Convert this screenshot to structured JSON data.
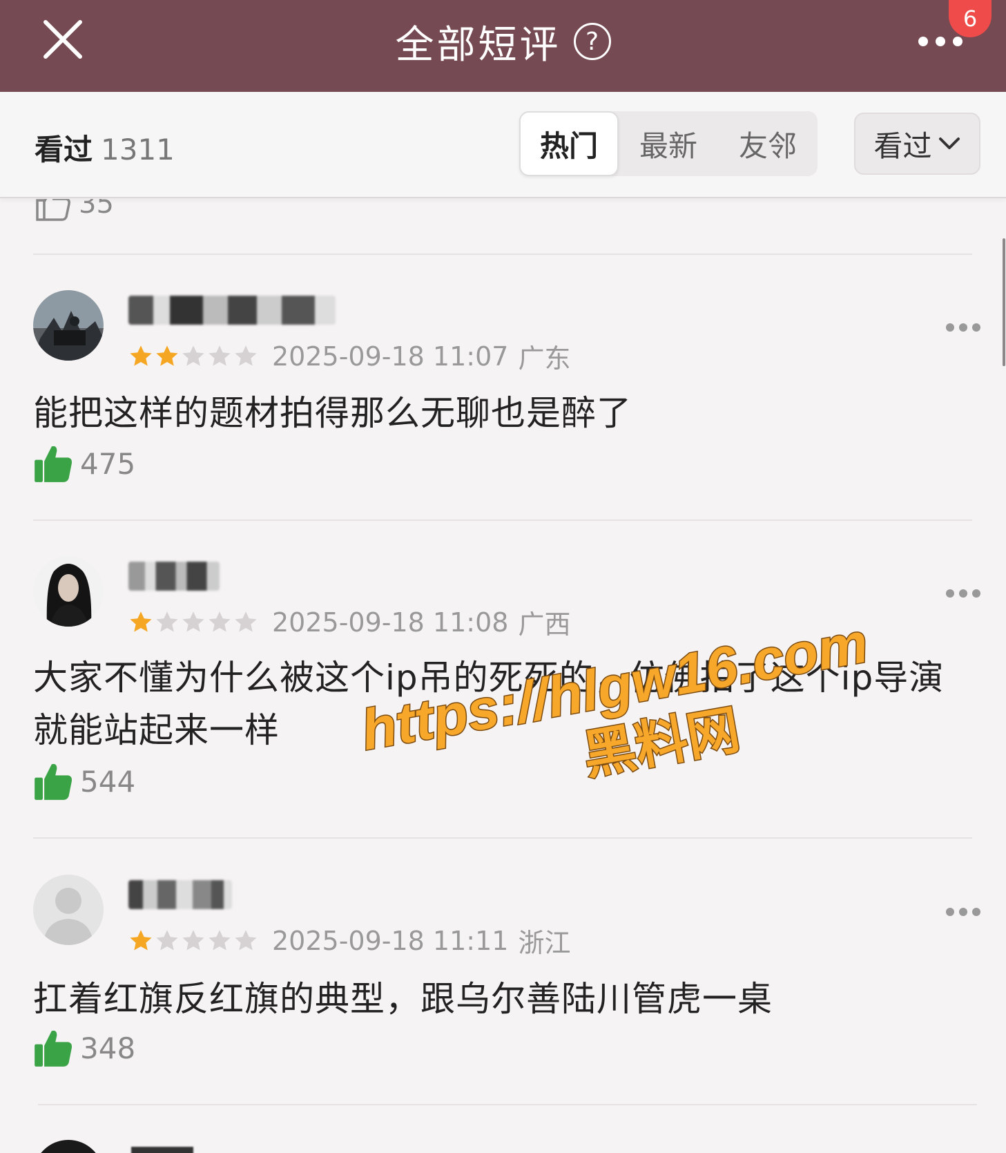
{
  "header": {
    "title": "全部短评",
    "help_glyph": "?",
    "notification_count": "6",
    "bg_color": "#764a52"
  },
  "filter": {
    "seen_label": "看过",
    "seen_count": "1311",
    "tabs": [
      {
        "label": "热门",
        "active": true
      },
      {
        "label": "最新",
        "active": false
      },
      {
        "label": "友邻",
        "active": false
      }
    ],
    "dropdown_label": "看过"
  },
  "previous_review": {
    "likes": "35"
  },
  "reviews": [
    {
      "username": "",
      "rating": 2,
      "time": "2025-09-18 11:07",
      "location": "广东",
      "content": "能把这样的题材拍得那么无聊也是醉了",
      "likes": "475"
    },
    {
      "username": "",
      "rating": 1,
      "time": "2025-09-18 11:08",
      "location": "广西",
      "content": "大家不懂为什么被这个ip吊的死死的，仿佛拍了这个ip导演就能站起来一样",
      "likes": "544"
    },
    {
      "username": "",
      "rating": 1,
      "time": "2025-09-18 11:11",
      "location": "浙江",
      "content": "扛着红旗反红旗的典型，跟乌尔善陆川管虎一桌",
      "likes": "348"
    }
  ],
  "watermark": {
    "url": "https://hlgw16.com",
    "name": "黑料网"
  },
  "colors": {
    "star_on": "#f5a623",
    "star_off": "#d6d2d3",
    "thumb_green": "#3aa346",
    "watermark_orange": "#f7a82b"
  }
}
